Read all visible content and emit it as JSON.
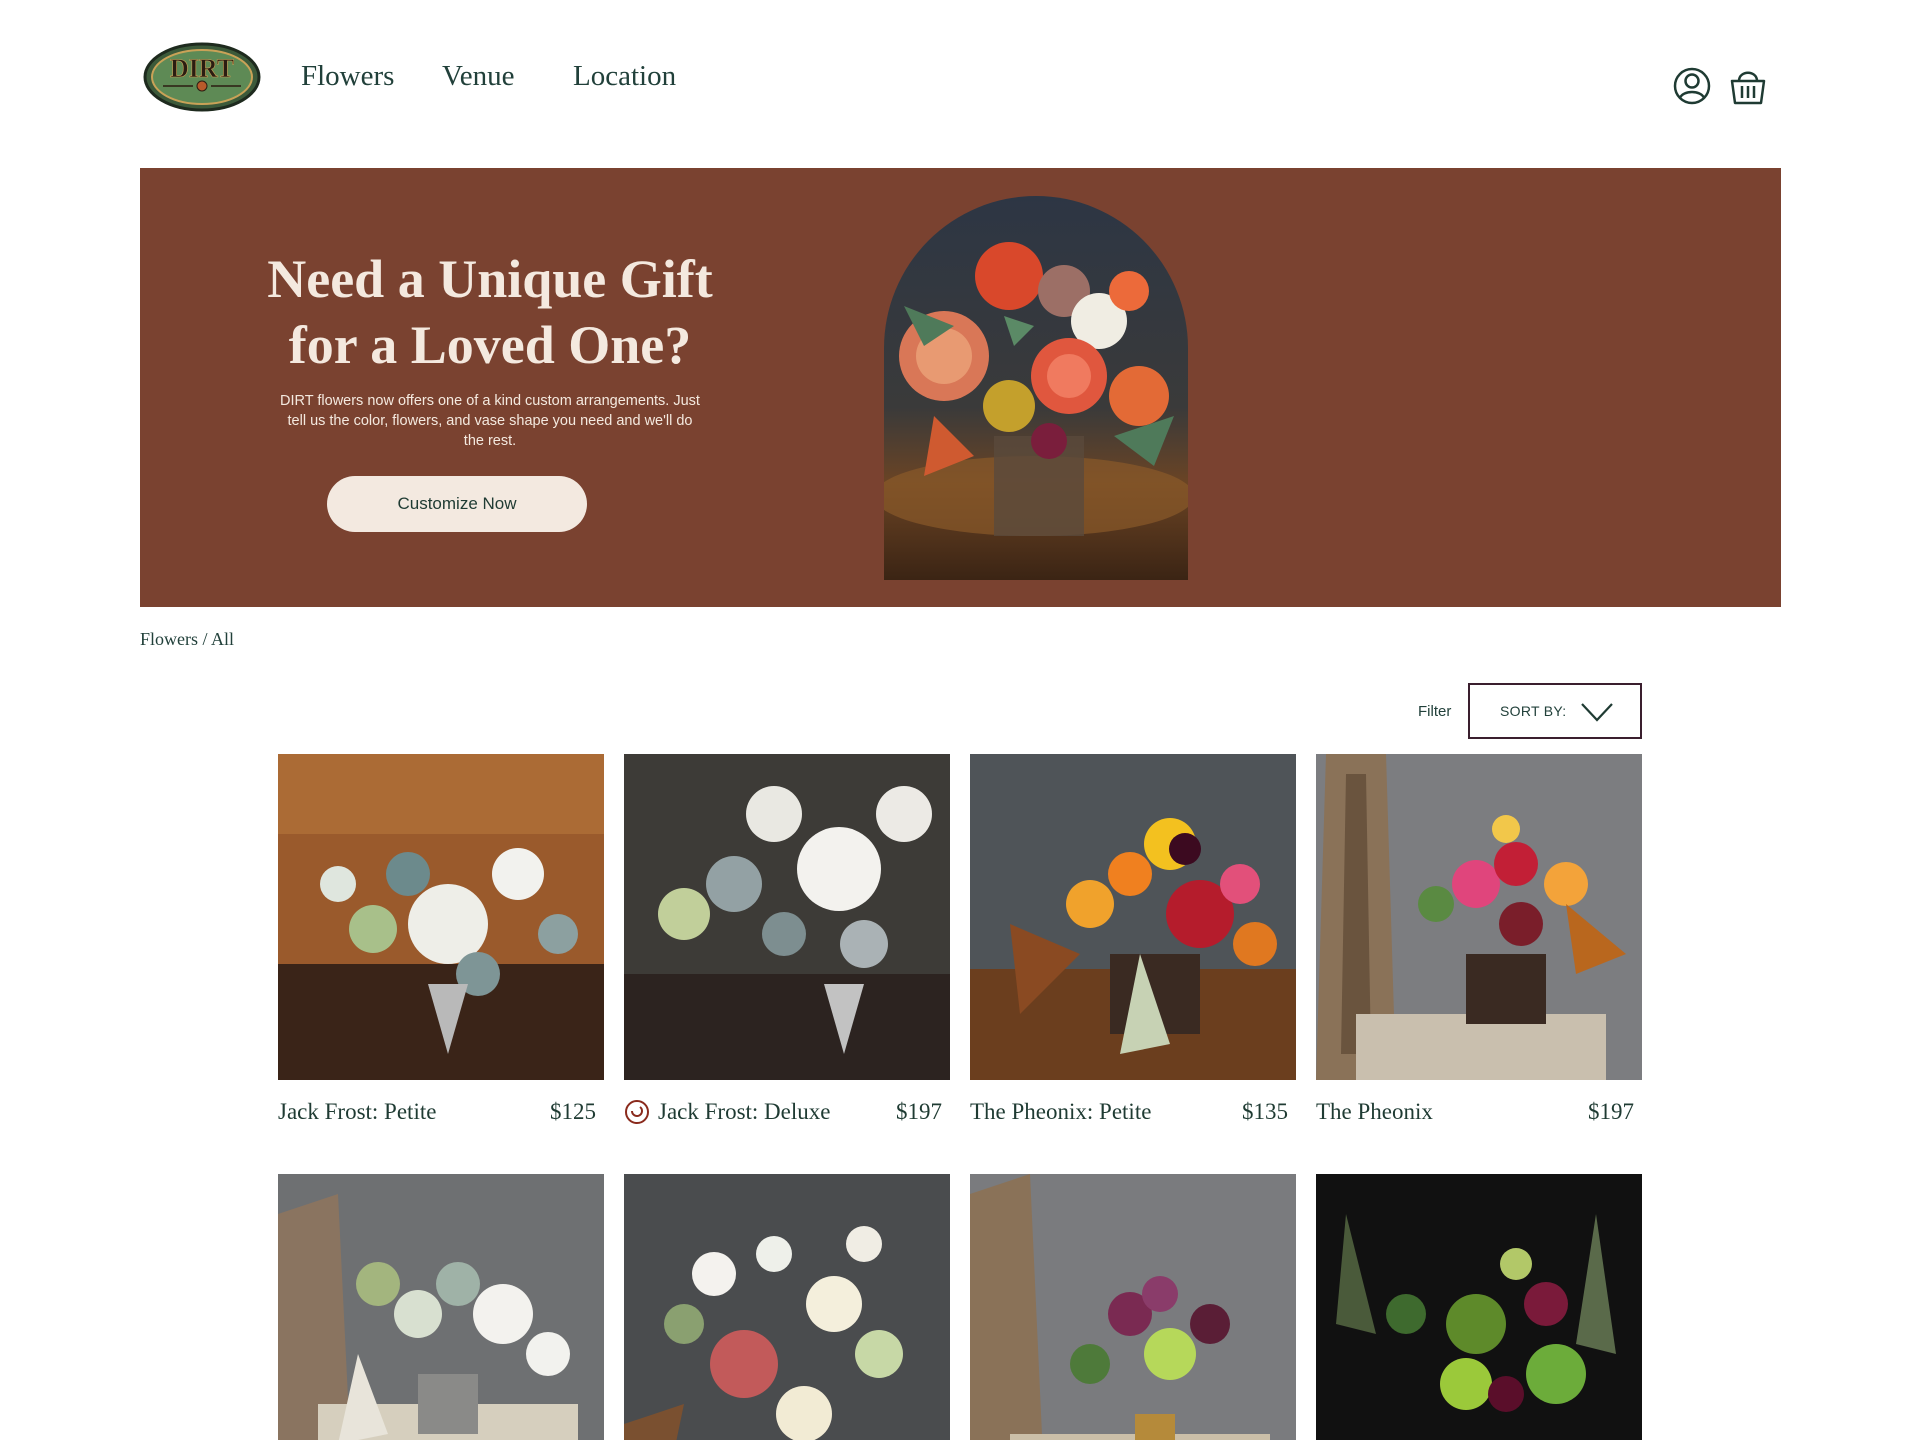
{
  "header": {
    "logo_text": "DIRT",
    "nav": [
      {
        "label": "Flowers"
      },
      {
        "label": "Venue"
      },
      {
        "label": "Location"
      }
    ],
    "icons": [
      "user-icon",
      "basket-icon"
    ]
  },
  "hero": {
    "title": "Need a Unique Gift for a Loved One?",
    "body": "DIRT flowers now offers one of a kind custom arrangements. Just tell us the color, flowers, and vase shape you need and we'll do the rest.",
    "cta_label": "Customize Now"
  },
  "breadcrumb": "Flowers / All",
  "controls": {
    "filter_label": "Filter",
    "sort_label": "SORT BY:"
  },
  "products": [
    {
      "name": "Jack Frost: Petite",
      "price": "$125"
    },
    {
      "name": "Jack Frost: Deluxe",
      "price": "$197"
    },
    {
      "name": "The Pheonix: Petite",
      "price": "$135"
    },
    {
      "name": "The Pheonix",
      "price": "$197"
    },
    {
      "name": "",
      "price": ""
    },
    {
      "name": "",
      "price": ""
    },
    {
      "name": "",
      "price": ""
    },
    {
      "name": "",
      "price": ""
    }
  ],
  "colors": {
    "hero_bg": "#7a4230",
    "cream": "#f4e9df",
    "dark_green": "#1f3b33",
    "sort_border": "#3a1f2e"
  }
}
